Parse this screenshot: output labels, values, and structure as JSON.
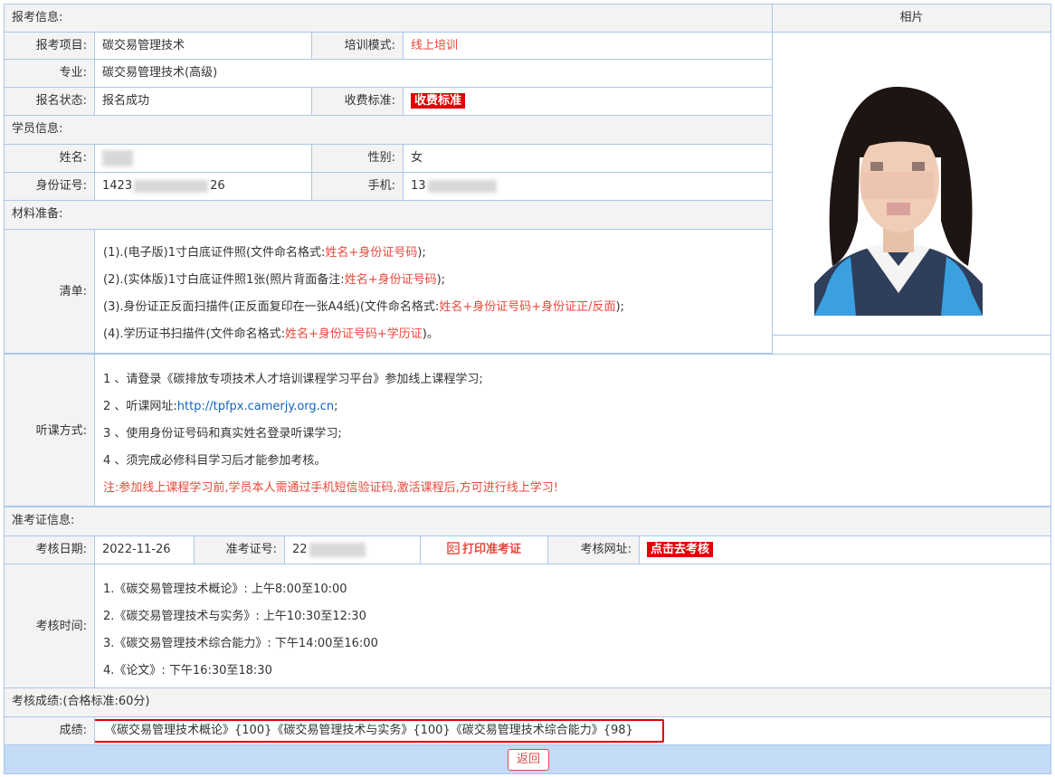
{
  "application": {
    "section_label": "报考信息:",
    "project_label": "报考项目:",
    "project_value": "碳交易管理技术",
    "training_mode_label": "培训模式:",
    "training_mode_value": "线上培训",
    "major_label": "专业:",
    "major_value": "碳交易管理技术(高级)",
    "status_label": "报名状态:",
    "status_value": "报名成功",
    "fee_label": "收费标准:",
    "fee_button": "收费标准"
  },
  "photo": {
    "header": "相片"
  },
  "student": {
    "section_label": "学员信息:",
    "name_label": "姓名:",
    "gender_label": "性别:",
    "gender_value": "女",
    "id_label": "身份证号:",
    "id_prefix": "1423",
    "id_suffix": "26",
    "phone_label": "手机:",
    "phone_prefix": "13"
  },
  "materials": {
    "section_label": "材料准备:",
    "list_label": "清单:",
    "items": [
      {
        "text": "(1).(电子版)1寸白底证件照(文件命名格式:",
        "highlight": "姓名+身份证号码",
        "end": ");"
      },
      {
        "text": "(2).(实体版)1寸白底证件照1张(照片背面备注:",
        "highlight": "姓名+身份证号码",
        "end": ");"
      },
      {
        "text": "(3).身份证正反面扫描件(正反面复印在一张A4纸)(文件命名格式:",
        "highlight": "姓名+身份证号码+身份证正/反面",
        "end": ");"
      },
      {
        "text": "(4).学历证书扫描件(文件命名格式:",
        "highlight": "姓名+身份证号码+学历证",
        "end": ")。"
      }
    ]
  },
  "lecture": {
    "label": "听课方式:",
    "line1": "1 、请登录《碳排放专项技术人才培训课程学习平台》参加线上课程学习;",
    "line2_prefix": "2 、听课网址:",
    "line2_link": "http://tpfpx.camerjy.org.cn",
    "line2_end": ";",
    "line3": "3 、使用身份证号码和真实姓名登录听课学习;",
    "line4": "4 、须完成必修科目学习后才能参加考核。",
    "note": "注:参加线上课程学习前,学员本人需通过手机短信验证码,激活课程后,方可进行线上学习!"
  },
  "admission": {
    "section_label": "准考证信息:",
    "date_label": "考核日期:",
    "date_value": "2022-11-26",
    "ticket_label": "准考证号:",
    "ticket_prefix": "22",
    "print_button": "打印准考证",
    "site_label": "考核网址:",
    "exam_button": "点击去考核",
    "time_label": "考核时间:",
    "times": [
      "1.《碳交易管理技术概论》: 上午8:00至10:00",
      "2.《碳交易管理技术与实务》: 上午10:30至12:30",
      "3.《碳交易管理技术综合能力》: 下午14:00至16:00",
      "4.《论文》: 下午16:30至18:30"
    ]
  },
  "results": {
    "section_label": "考核成绩:(合格标准:60分)",
    "score_label": "成绩:",
    "score_value": "《碳交易管理技术概论》{100}《碳交易管理技术与实务》{100}《碳交易管理技术综合能力》{98}"
  },
  "footer": {
    "back_button": "返回"
  },
  "colors": {
    "border": "#a9c7ec",
    "label_bg": "#f3f3f3",
    "accent_red": "#e00000",
    "link": "#1565c0",
    "footer_bg": "#c3dbf6"
  },
  "icons": {
    "print": "id-card-icon"
  }
}
